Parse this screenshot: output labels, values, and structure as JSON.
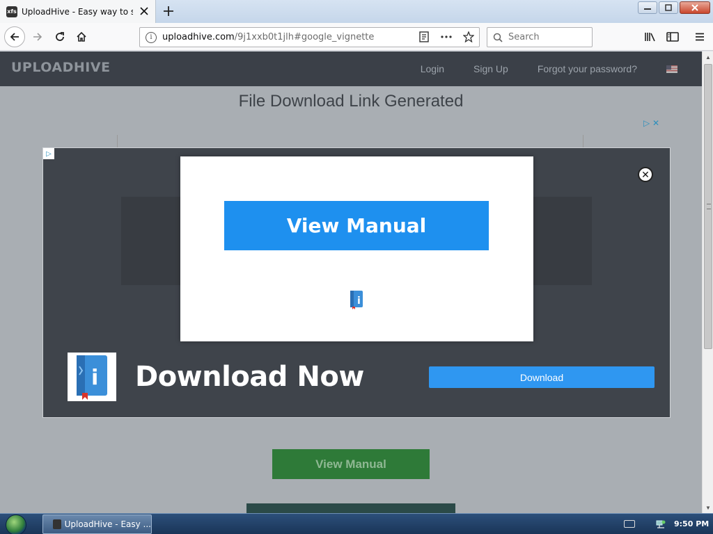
{
  "browser": {
    "tab": {
      "favicon_text": "xfs",
      "title": "UploadHive - Easy way to share"
    },
    "url": {
      "host": "uploadhive.com",
      "path": "/9j1xxb0t1jlh#google_vignette"
    },
    "search": {
      "placeholder": "Search"
    },
    "icons": {
      "back": "back-arrow-icon",
      "forward": "forward-arrow-icon",
      "reload": "reload-icon",
      "home": "home-icon",
      "info": "info-icon",
      "reader": "reader-view-icon",
      "page_actions": "more-actions-icon",
      "bookmark": "bookmark-star-icon",
      "library": "library-icon",
      "sidebar": "sidebar-icon",
      "menu": "hamburger-menu-icon"
    }
  },
  "site": {
    "logo": "UPLOADHIVE",
    "nav": {
      "login": "Login",
      "signup": "Sign Up",
      "forgot": "Forgot your password?"
    },
    "heading": "File Download Link Generated",
    "background_button": "View Manual"
  },
  "ad": {
    "modal_button": "View Manual",
    "headline": "Download Now",
    "download_button": "Download",
    "close_glyph": "✕",
    "adchoices_glyph": "▷",
    "adchoices_top": "▷ ✕"
  },
  "taskbar": {
    "task_label": "UploadHive - Easy ...",
    "clock": "9:50 PM"
  },
  "colors": {
    "header_bg": "#3b4048",
    "ad_blue": "#1e90ef",
    "bg_button_green": "#2e7a38",
    "overlay_bg": "#a9aeb3"
  }
}
